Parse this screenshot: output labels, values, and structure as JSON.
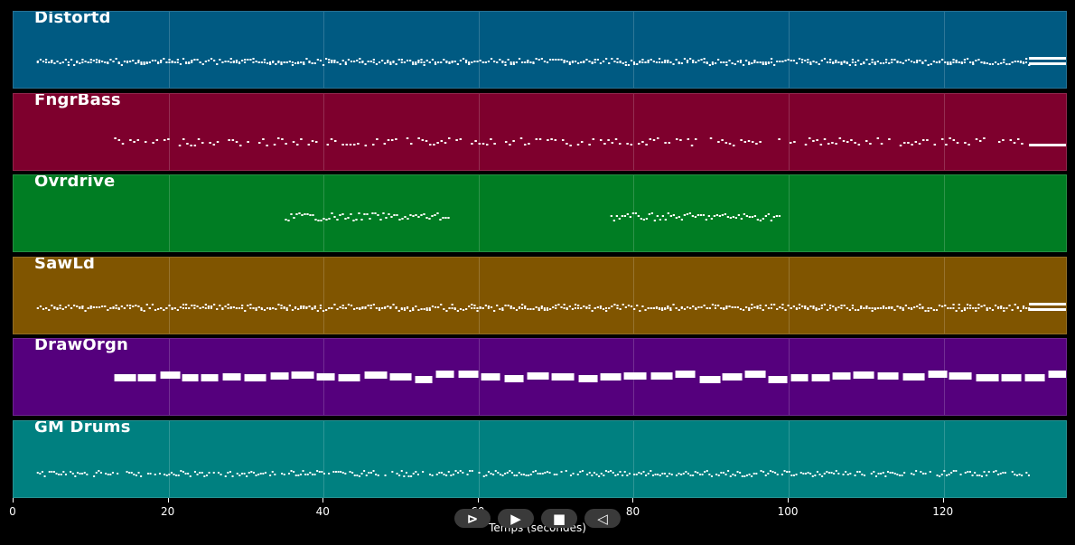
{
  "tracks": [
    {
      "name": "Distortd",
      "color": "#005a82",
      "pattern": "dense",
      "range": [
        3,
        131
      ],
      "tail": "double"
    },
    {
      "name": "FngrBass",
      "color": "#7e002d",
      "pattern": "sparse",
      "range": [
        12,
        131
      ],
      "tail": "single"
    },
    {
      "name": "Ovrdrive",
      "color": "#007d23",
      "pattern": "segments",
      "range": [
        35,
        99
      ],
      "tail": "none"
    },
    {
      "name": "SawLd",
      "color": "#805500",
      "pattern": "dense",
      "range": [
        3,
        131
      ],
      "tail": "double"
    },
    {
      "name": "DrawOrgn",
      "color": "#55007d",
      "pattern": "blocks",
      "range": [
        13,
        136
      ],
      "tail": "none"
    },
    {
      "name": "GM Drums",
      "color": "#008080",
      "pattern": "drums",
      "range": [
        3,
        131
      ],
      "tail": "none"
    }
  ],
  "axis": {
    "title": "Temps (secondes)",
    "ticks": [
      "0",
      "20",
      "40",
      "60",
      "80",
      "100",
      "120"
    ],
    "tick_values": [
      0,
      20,
      40,
      60,
      80,
      100,
      120
    ],
    "max": 136
  },
  "controls": [
    {
      "name": "skip-back-icon",
      "glyph": "⊳"
    },
    {
      "name": "play-icon",
      "glyph": "▶"
    },
    {
      "name": "stop-icon",
      "glyph": "■"
    },
    {
      "name": "rewind-icon",
      "glyph": "◁"
    }
  ]
}
